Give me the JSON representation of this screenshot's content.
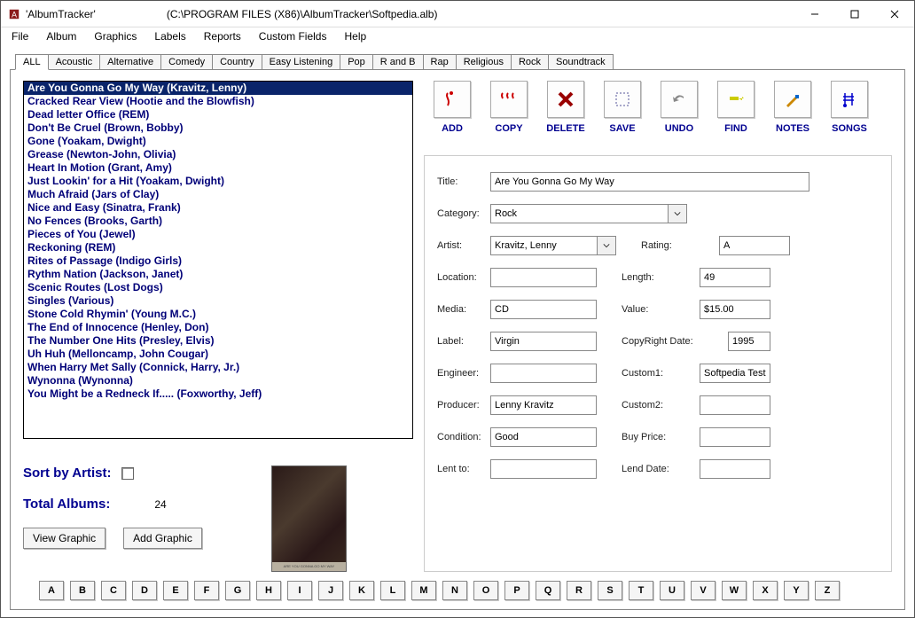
{
  "window": {
    "app_title": "'AlbumTracker'",
    "path": "(C:\\PROGRAM FILES (X86)\\AlbumTracker\\Softpedia.alb)"
  },
  "menu": [
    "File",
    "Album",
    "Graphics",
    "Labels",
    "Reports",
    "Custom Fields",
    "Help"
  ],
  "tabs": [
    "ALL",
    "Acoustic",
    "Alternative",
    "Comedy",
    "Country",
    "Easy Listening",
    "Pop",
    "R and B",
    "Rap",
    "Religious",
    "Rock",
    "Soundtrack"
  ],
  "active_tab": 0,
  "albums": [
    "Are You Gonna Go My Way (Kravitz, Lenny)",
    "Cracked Rear View (Hootie and the Blowfish)",
    "Dead letter Office (REM)",
    "Don't Be Cruel (Brown, Bobby)",
    "Gone (Yoakam, Dwight)",
    "Grease (Newton-John, Olivia)",
    "Heart In Motion (Grant, Amy)",
    "Just Lookin' for a Hit (Yoakam, Dwight)",
    "Much Afraid (Jars of Clay)",
    "Nice and Easy (Sinatra, Frank)",
    "No Fences (Brooks, Garth)",
    "Pieces of You (Jewel)",
    "Reckoning (REM)",
    "Rites of Passage (Indigo Girls)",
    "Rythm Nation (Jackson, Janet)",
    "Scenic Routes (Lost Dogs)",
    "Singles (Various)",
    "Stone Cold Rhymin' (Young M.C.)",
    "The End of Innocence (Henley, Don)",
    "The Number One Hits (Presley, Elvis)",
    "Uh Huh (Melloncamp, John Cougar)",
    "When Harry Met Sally (Connick, Harry, Jr.)",
    "Wynonna (Wynonna)",
    "You Might be a Redneck If..... (Foxworthy, Jeff)"
  ],
  "selected_album": 0,
  "stats": {
    "sort_label": "Sort by Artist:",
    "total_label": "Total Albums:",
    "total_value": "24",
    "view_graphic": "View Graphic",
    "add_graphic": "Add Graphic"
  },
  "toolbar": [
    {
      "key": "add",
      "label": "ADD"
    },
    {
      "key": "copy",
      "label": "COPY"
    },
    {
      "key": "delete",
      "label": "DELETE"
    },
    {
      "key": "save",
      "label": "SAVE"
    },
    {
      "key": "undo",
      "label": "UNDO"
    },
    {
      "key": "find",
      "label": "FIND"
    },
    {
      "key": "notes",
      "label": "NOTES"
    },
    {
      "key": "songs",
      "label": "SONGS"
    }
  ],
  "form": {
    "labels": {
      "title": "Title:",
      "category": "Category:",
      "artist": "Artist:",
      "rating": "Rating:",
      "location": "Location:",
      "length": "Length:",
      "media": "Media:",
      "value": "Value:",
      "label": "Label:",
      "copyright": "CopyRight Date:",
      "engineer": "Engineer:",
      "custom1": "Custom1:",
      "producer": "Producer:",
      "custom2": "Custom2:",
      "condition": "Condition:",
      "buyprice": "Buy Price:",
      "lentto": "Lent to:",
      "lenddate": "Lend Date:"
    },
    "values": {
      "title": "Are You Gonna Go My Way",
      "category": "Rock",
      "artist": "Kravitz, Lenny",
      "rating": "A",
      "location": "",
      "length": "49",
      "media": "CD",
      "value": "$15.00",
      "label": "Virgin",
      "copyright": "1995",
      "engineer": "",
      "custom1": "Softpedia Test",
      "producer": "Lenny Kravitz",
      "custom2": "",
      "condition": "Good",
      "buyprice": "",
      "lentto": "",
      "lenddate": ""
    }
  },
  "alpha": [
    "A",
    "B",
    "C",
    "D",
    "E",
    "F",
    "G",
    "H",
    "I",
    "J",
    "K",
    "L",
    "M",
    "N",
    "O",
    "P",
    "Q",
    "R",
    "S",
    "T",
    "U",
    "V",
    "W",
    "X",
    "Y",
    "Z"
  ]
}
